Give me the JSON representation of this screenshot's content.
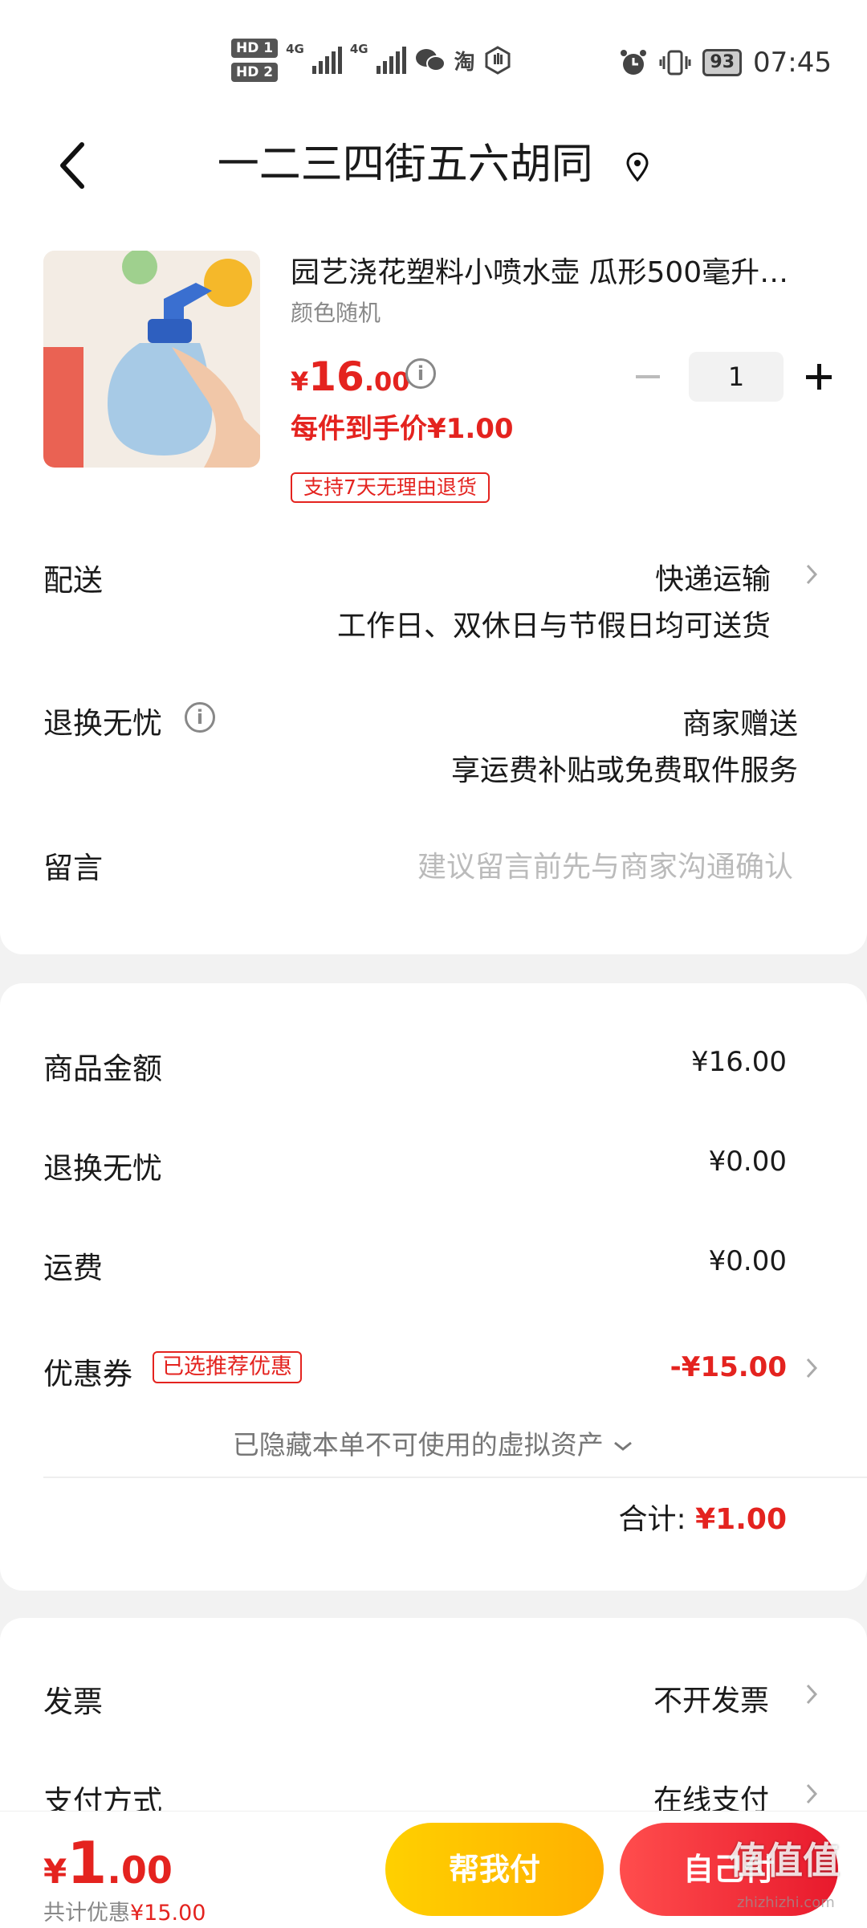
{
  "status_bar": {
    "hd1": "HD 1",
    "hd2": "HD 2",
    "net1": "4G",
    "net2": "4G",
    "taobao": "淘",
    "battery": "93",
    "time": "07:45"
  },
  "header": {
    "address": "一二三四街五六胡同"
  },
  "product": {
    "title": "园艺浇花塑料小喷水壶 瓜形500毫升…",
    "spec": "颜色随机",
    "price_symbol": "¥",
    "price_int": "16",
    "price_dec": ".00",
    "quantity": "1",
    "deal_price": "每件到手价¥1.00",
    "return_badge": "支持7天无理由退货"
  },
  "delivery": {
    "label": "配送",
    "method": "快递运输",
    "note": "工作日、双休日与节假日均可送货"
  },
  "return_worry": {
    "label": "退换无忧",
    "value": "商家赠送",
    "note": "享运费补贴或免费取件服务"
  },
  "message": {
    "label": "留言",
    "placeholder": "建议留言前先与商家沟通确认"
  },
  "summary": {
    "goods_label": "商品金额",
    "goods_value": "¥16.00",
    "return_label": "退换无忧",
    "return_value": "¥0.00",
    "shipping_label": "运费",
    "shipping_value": "¥0.00",
    "coupon_label": "优惠券",
    "coupon_tag": "已选推荐优惠",
    "coupon_value": "-¥15.00",
    "hidden_note": "已隐藏本单不可使用的虚拟资产",
    "total_label": "合计:",
    "total_value": "¥1.00"
  },
  "invoice": {
    "label": "发票",
    "value": "不开发票"
  },
  "payment_method": {
    "label": "支付方式",
    "value": "在线支付"
  },
  "bottom": {
    "symbol": "¥",
    "int": "1",
    "dec": ".00",
    "saved_label": "共计优惠",
    "saved_value": "¥15.00",
    "help_pay": "帮我付",
    "self_pay": "自己付",
    "watermark": "值值值",
    "watermark_url": "zhizhizhi.com"
  },
  "colors": {
    "accent_red": "#e4231f",
    "help_yellow": "#ffc400",
    "self_red": "#f0263a"
  }
}
